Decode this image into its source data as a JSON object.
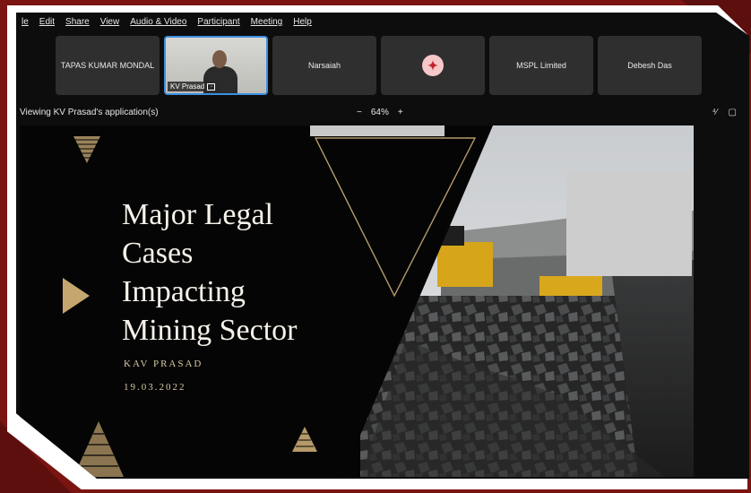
{
  "menubar": {
    "items": [
      "le",
      "Edit",
      "Share",
      "View",
      "Audio & Video",
      "Participant",
      "Meeting",
      "Help"
    ]
  },
  "participants": [
    {
      "name": "TAPAS KUMAR MONDAL",
      "type": "name"
    },
    {
      "name": "KV Prasad",
      "type": "video",
      "active": true
    },
    {
      "name": "Narsaiah",
      "type": "name"
    },
    {
      "name": "",
      "type": "logo",
      "icon": "org-logo-icon"
    },
    {
      "name": "MSPL Limited",
      "type": "name"
    },
    {
      "name": "Debesh Das",
      "type": "name"
    }
  ],
  "viewbar": {
    "viewing_text": "Viewing KV Prasad's application(s)",
    "zoom_minus": "−",
    "zoom_level": "64%",
    "zoom_plus": "+",
    "icons": [
      "annotate-icon",
      "chat-icon"
    ]
  },
  "slide": {
    "title_lines": [
      "Major Legal",
      "Cases",
      "Impacting",
      "Mining Sector"
    ],
    "presenter": "KAV PRASAD",
    "date": "19.03.2022"
  },
  "colors": {
    "accent_gold": "#b59a6a",
    "background_red": "#7a1512",
    "active_border": "#3d8fe0"
  }
}
